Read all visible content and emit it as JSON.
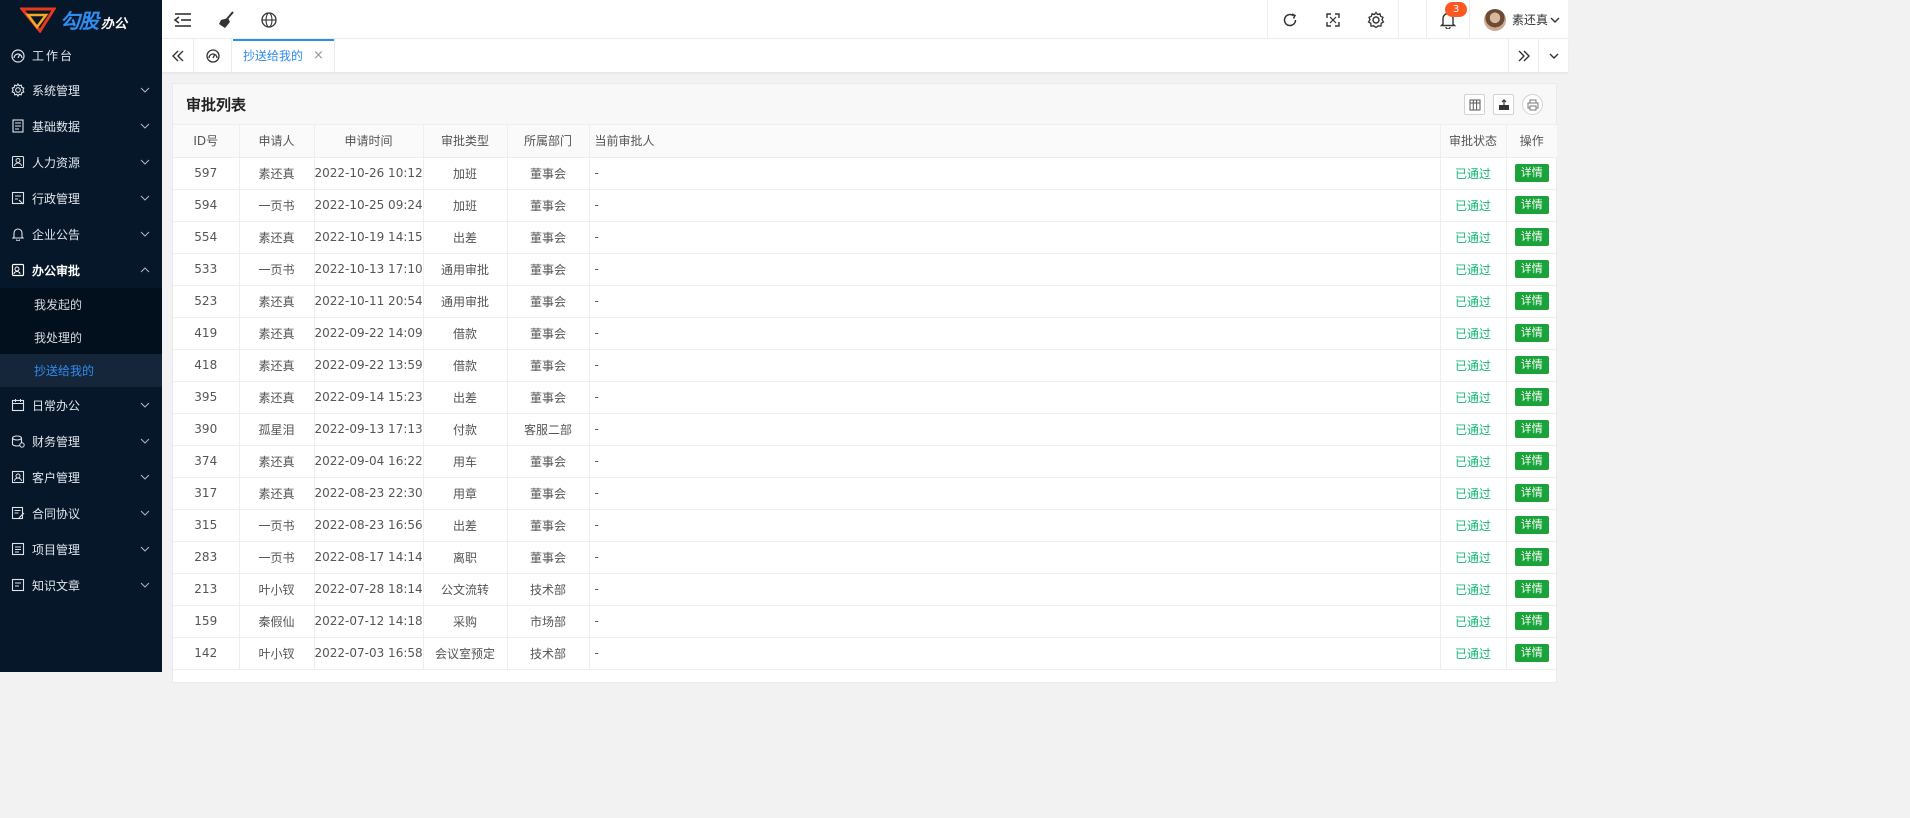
{
  "brand": {
    "name": "勾股",
    "sub": "办公"
  },
  "sidebar": {
    "workbench": "工作台",
    "items": [
      {
        "label": "系统管理",
        "icon": "gear-icon"
      },
      {
        "label": "基础数据",
        "icon": "database-icon"
      },
      {
        "label": "人力资源",
        "icon": "person-card-icon"
      },
      {
        "label": "行政管理",
        "icon": "admin-doc-icon"
      },
      {
        "label": "企业公告",
        "icon": "bell-icon"
      },
      {
        "label": "办公审批",
        "icon": "approval-icon",
        "open": true
      },
      {
        "label": "日常办公",
        "icon": "calendar-icon"
      },
      {
        "label": "财务管理",
        "icon": "money-icon"
      },
      {
        "label": "客户管理",
        "icon": "customer-icon"
      },
      {
        "label": "合同协议",
        "icon": "contract-icon"
      },
      {
        "label": "项目管理",
        "icon": "project-icon"
      },
      {
        "label": "知识文章",
        "icon": "article-icon"
      }
    ],
    "sub_items": [
      "我发起的",
      "我处理的",
      "抄送给我的"
    ],
    "active_sub": "抄送给我的"
  },
  "header": {
    "notification_count": "3",
    "user_name": "素还真"
  },
  "tabs": {
    "active_label": "抄送给我的",
    "close_symbol": "×"
  },
  "card": {
    "title": "审批列表",
    "columns": [
      "ID号",
      "申请人",
      "申请时间",
      "审批类型",
      "所属部门",
      "当前审批人",
      "审批状态",
      "操作"
    ],
    "detail_label": "详情",
    "rows": [
      [
        "597",
        "素还真",
        "2022-10-26 10:12",
        "加班",
        "董事会",
        "-",
        "已通过"
      ],
      [
        "594",
        "一页书",
        "2022-10-25 09:24",
        "加班",
        "董事会",
        "-",
        "已通过"
      ],
      [
        "554",
        "素还真",
        "2022-10-19 14:15",
        "出差",
        "董事会",
        "-",
        "已通过"
      ],
      [
        "533",
        "一页书",
        "2022-10-13 17:10",
        "通用审批",
        "董事会",
        "-",
        "已通过"
      ],
      [
        "523",
        "素还真",
        "2022-10-11 20:54",
        "通用审批",
        "董事会",
        "-",
        "已通过"
      ],
      [
        "419",
        "素还真",
        "2022-09-22 14:09",
        "借款",
        "董事会",
        "-",
        "已通过"
      ],
      [
        "418",
        "素还真",
        "2022-09-22 13:59",
        "借款",
        "董事会",
        "-",
        "已通过"
      ],
      [
        "395",
        "素还真",
        "2022-09-14 15:23",
        "出差",
        "董事会",
        "-",
        "已通过"
      ],
      [
        "390",
        "孤星泪",
        "2022-09-13 17:13",
        "付款",
        "客服二部",
        "-",
        "已通过"
      ],
      [
        "374",
        "素还真",
        "2022-09-04 16:22",
        "用车",
        "董事会",
        "-",
        "已通过"
      ],
      [
        "317",
        "素还真",
        "2022-08-23 22:30",
        "用章",
        "董事会",
        "-",
        "已通过"
      ],
      [
        "315",
        "一页书",
        "2022-08-23 16:56",
        "出差",
        "董事会",
        "-",
        "已通过"
      ],
      [
        "283",
        "一页书",
        "2022-08-17 14:14",
        "离职",
        "董事会",
        "-",
        "已通过"
      ],
      [
        "213",
        "叶小钗",
        "2022-07-28 18:14",
        "公文流转",
        "技术部",
        "-",
        "已通过"
      ],
      [
        "159",
        "秦假仙",
        "2022-07-12 14:18",
        "采购",
        "市场部",
        "-",
        "已通过"
      ],
      [
        "142",
        "叶小钗",
        "2022-07-03 16:58",
        "会议室预定",
        "技术部",
        "-",
        "已通过"
      ]
    ]
  },
  "colors": {
    "sidebar_bg": "#061729",
    "accent": "#2f8cf0",
    "status_green": "#16b777",
    "badge": "#ff5722"
  }
}
